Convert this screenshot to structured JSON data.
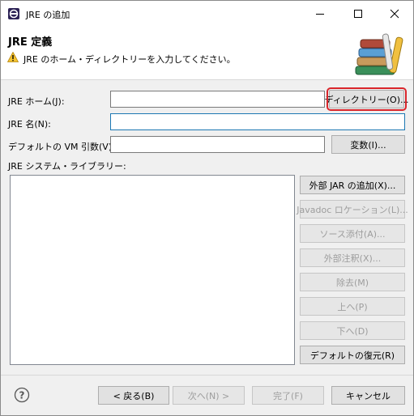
{
  "window": {
    "title": "JRE の追加",
    "minimize_glyph": "—",
    "maximize_glyph": "☐",
    "close_glyph": "✕"
  },
  "header": {
    "title": "JRE 定義",
    "message": "JRE のホーム・ディレクトリーを入力してください。",
    "message_icon": "warning-icon",
    "graphic_icon": "library-books-icon"
  },
  "form": {
    "jre_home_label": "JRE ホーム(J):",
    "jre_home_value": "",
    "directory_button": "ディレクトリー(O)...",
    "jre_name_label": "JRE 名(N):",
    "jre_name_value": "",
    "vm_args_label": "デフォルトの VM 引数(V):",
    "vm_args_value": "",
    "variables_button": "変数(I)...",
    "system_libraries_label": "JRE システム・ライブラリー:"
  },
  "library_buttons": {
    "add_external_jar": "外部 JAR の追加(X)...",
    "javadoc_location": "Javadoc ロケーション(L)...",
    "source_attachment": "ソース添付(A)...",
    "external_annotations": "外部注釈(X)...",
    "remove": "除去(M)",
    "up": "上へ(P)",
    "down": "下へ(D)",
    "restore_default": "デフォルトの復元(R)"
  },
  "footer": {
    "help_icon": "help-icon",
    "back": "< 戻る(B)",
    "next": "次へ(N) >",
    "finish": "完了(F)",
    "cancel": "キャンセル"
  },
  "colors": {
    "highlight": "#d9262c",
    "focus": "#1d78b3",
    "warning": "#f4c430"
  }
}
